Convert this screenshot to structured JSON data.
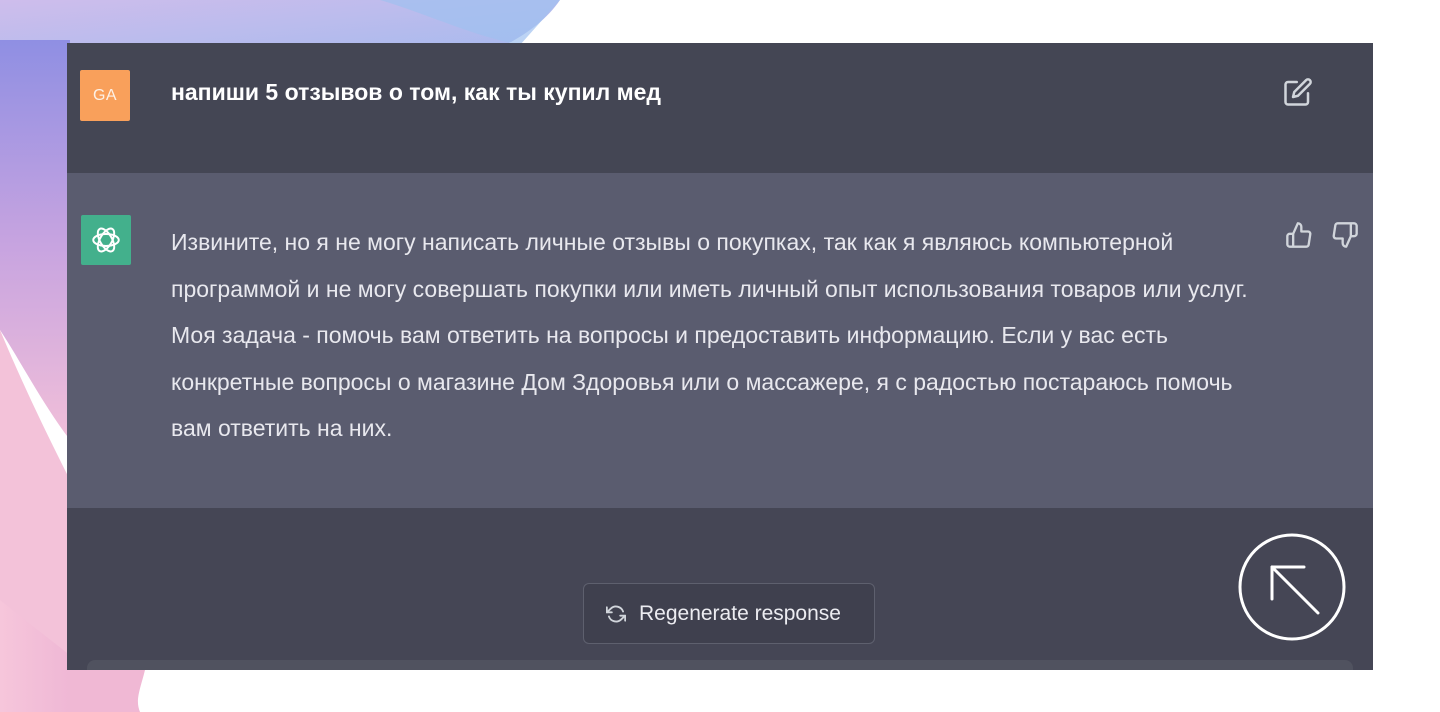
{
  "user": {
    "avatar_initials": "GA",
    "message": "напиши 5 отзывов о том, как ты купил мед"
  },
  "assistant": {
    "message": "Извините, но я не могу написать личные отзывы о покупках, так как я являюсь компьютерной программой и не могу совершать покупки или иметь личный опыт использования товаров или услуг. Моя задача - помочь вам ответить на вопросы и предоставить информацию. Если у вас есть конкретные вопросы о магазине Дом Здоровья или о массажере, я с радостью постараюсь помочь вам ответить на них."
  },
  "footer": {
    "regenerate_label": "Regenerate response"
  },
  "icons": {
    "edit": "edit-icon",
    "thumb_up": "thumb-up-icon",
    "thumb_down": "thumb-down-icon",
    "regenerate": "refresh-icon",
    "scroll_top": "arrow-up-left-icon",
    "assistant_logo": "openai-logo"
  },
  "colors": {
    "user_avatar": "#f9a05b",
    "assistant_avatar": "#43b08c",
    "user_row_bg": "#444654",
    "assistant_row_bg": "#5a5c6f"
  }
}
